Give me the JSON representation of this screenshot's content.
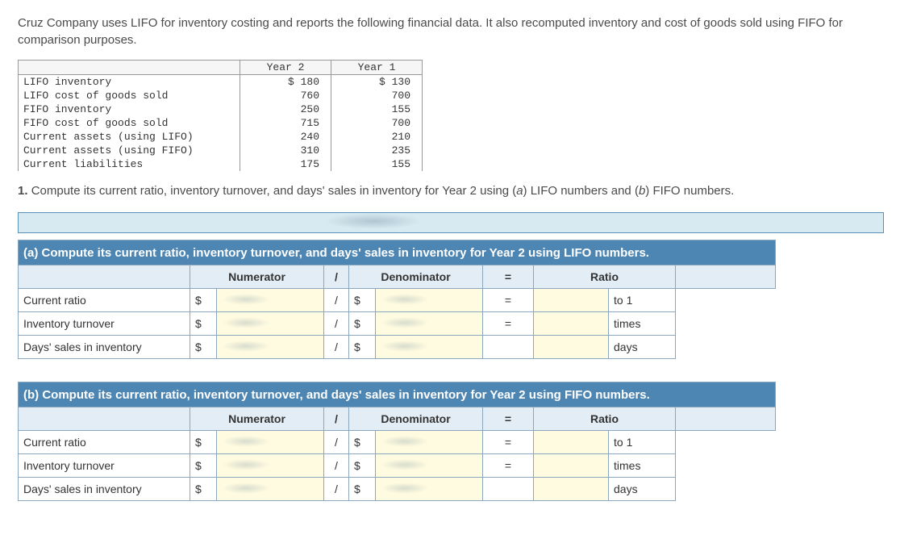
{
  "intro": "Cruz Company uses LIFO for inventory costing and reports the following financial data. It also recomputed inventory and cost of goods sold using FIFO for comparison purposes.",
  "data_table": {
    "headers": [
      "",
      "Year 2",
      "Year 1"
    ],
    "rows": [
      {
        "label": "LIFO inventory",
        "y2": "$ 180",
        "y1": "$ 130"
      },
      {
        "label": "LIFO cost of goods sold",
        "y2": "760",
        "y1": "700"
      },
      {
        "label": "FIFO inventory",
        "y2": "250",
        "y1": "155"
      },
      {
        "label": "FIFO cost of goods sold",
        "y2": "715",
        "y1": "700"
      },
      {
        "label": "Current assets (using LIFO)",
        "y2": "240",
        "y1": "210"
      },
      {
        "label": "Current assets (using FIFO)",
        "y2": "310",
        "y1": "235"
      },
      {
        "label": "Current liabilities",
        "y2": "175",
        "y1": "155"
      }
    ]
  },
  "question1_prefix": "1. ",
  "question1_a": "Compute its current ratio, inventory turnover, and days' sales in inventory for Year 2 using (",
  "question1_b": "a",
  "question1_c": ") LIFO numbers and (",
  "question1_d": "b",
  "question1_e": ") FIFO numbers.",
  "calc": {
    "headers": {
      "num": "Numerator",
      "slash": "/",
      "den": "Denominator",
      "eq": "=",
      "ratio": "Ratio"
    },
    "sections": [
      {
        "title": "(a) Compute its current ratio, inventory turnover, and days' sales in inventory for Year 2 using LIFO numbers.",
        "rows": [
          {
            "label": "Current ratio",
            "slash": "/",
            "eq": "=",
            "unit": "to 1"
          },
          {
            "label": "Inventory turnover",
            "slash": "/",
            "eq": "=",
            "unit": "times"
          },
          {
            "label": "Days' sales in inventory",
            "slash": "/",
            "eq": "",
            "unit": "days"
          }
        ]
      },
      {
        "title": "(b) Compute its current ratio, inventory turnover, and days' sales in inventory for Year 2 using FIFO numbers.",
        "rows": [
          {
            "label": "Current ratio",
            "slash": "/",
            "eq": "=",
            "unit": "to 1"
          },
          {
            "label": "Inventory turnover",
            "slash": "/",
            "eq": "=",
            "unit": "times"
          },
          {
            "label": "Days' sales in inventory",
            "slash": "/",
            "eq": "",
            "unit": "days"
          }
        ]
      }
    ],
    "dollar": "$"
  }
}
